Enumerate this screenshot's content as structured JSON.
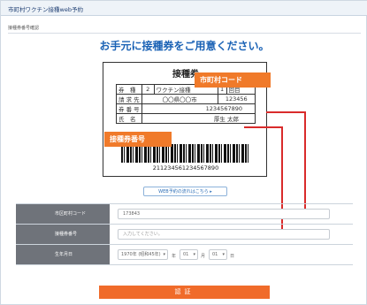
{
  "header": {
    "title": "市町村ワクチン接種web予約"
  },
  "subheader": {
    "title": "接種券番号確認"
  },
  "headline": "お手元に接種券をご用意ください。",
  "ticket": {
    "title": "接種券",
    "rows": [
      [
        "券　種",
        "2",
        "ワクチン接種",
        "1",
        "回目"
      ],
      [
        "請 求 先",
        "〇〇県〇〇市",
        "123456"
      ],
      [
        "券 番 号",
        "1234567890"
      ],
      [
        "氏　名",
        "厚生 太郎"
      ]
    ],
    "barcode_number": "211234561234567890",
    "tag_municipality": "市町村コード",
    "tag_ticket": "接種券番号"
  },
  "help_link": "WEB予約の流れはこちら ▸",
  "form": {
    "rows": [
      {
        "label": "市区町村コード",
        "value": "173843"
      },
      {
        "label": "接種券番号",
        "placeholder": "入力してください。"
      },
      {
        "label": "生年月日",
        "year": "1970年 (昭和45年)",
        "year_suffix": "年",
        "month": "01",
        "month_suffix": "月",
        "day": "01",
        "day_suffix": "日"
      }
    ]
  },
  "submit": "認証",
  "colors": {
    "accent": "#f07a2a",
    "arrow": "#d92b2b",
    "link": "#1a62b5"
  }
}
